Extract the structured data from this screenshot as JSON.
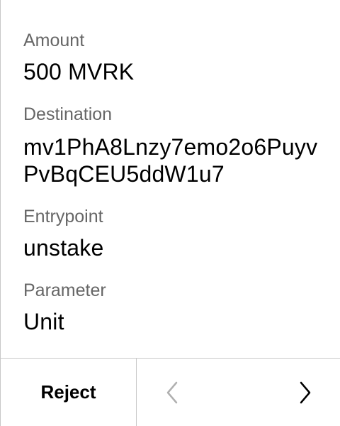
{
  "fields": {
    "amount": {
      "label": "Amount",
      "value": "500 MVRK"
    },
    "destination": {
      "label": "Destination",
      "value": "mv1PhA8Lnzy7emo2o6PuyvPvBqCEU5ddW1u7"
    },
    "entrypoint": {
      "label": "Entrypoint",
      "value": "unstake"
    },
    "parameter": {
      "label": "Parameter",
      "value": "Unit"
    }
  },
  "footer": {
    "reject_label": "Reject",
    "prev_icon": "chevron-left-icon",
    "next_icon": "chevron-right-icon",
    "prev_enabled": false,
    "next_enabled": true
  },
  "colors": {
    "label": "#666666",
    "value": "#000000",
    "divider": "#c8c8c8",
    "disabled_icon": "#b0b0b0"
  }
}
